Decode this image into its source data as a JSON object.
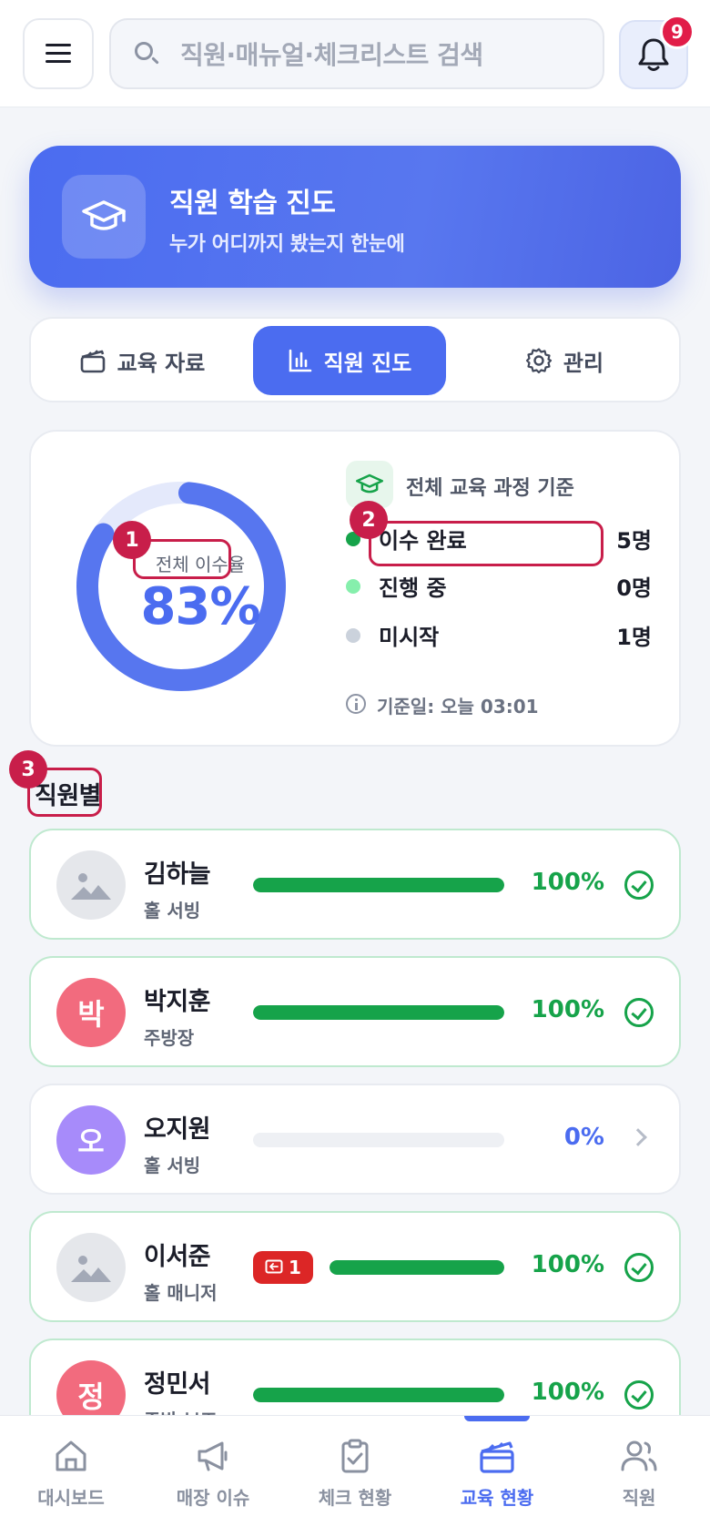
{
  "header": {
    "search_placeholder": "직원·매뉴얼·체크리스트 검색",
    "notification_count": "9",
    "icons": {
      "menu": "menu-icon",
      "search": "search-icon",
      "bell": "bell-icon"
    }
  },
  "hero": {
    "title": "직원 학습 진도",
    "subtitle": "누가 어디까지 봤는지 한눈에",
    "icon": "graduation-cap-icon"
  },
  "tabs": [
    {
      "label": "교육 자료",
      "icon": "clapperboard-icon",
      "active": false
    },
    {
      "label": "직원 진도",
      "icon": "bar-chart-icon",
      "active": true
    },
    {
      "label": "관리",
      "icon": "gear-icon",
      "active": false
    }
  ],
  "summary": {
    "completion_label": "전체 이수율",
    "completion_value": "83%",
    "completion_fraction": 0.83,
    "basis": "전체 교육 과정 기준",
    "stats": [
      {
        "label": "이수 완료",
        "value": "5명",
        "color": "#16a34a"
      },
      {
        "label": "진행 중",
        "value": "0명",
        "color": "#86efac"
      },
      {
        "label": "미시작",
        "value": "1명",
        "color": "#cbd2dc"
      }
    ],
    "as_of": "기준일: 오늘 03:01"
  },
  "annotations": [
    "1",
    "2",
    "3"
  ],
  "section_title": "직원별",
  "employees": [
    {
      "name": "김하늘",
      "role": "홀 서빙",
      "avatar": "",
      "avatar_type": "photo",
      "progress": 1.0,
      "percent": "100%",
      "status": "check",
      "feedback": null
    },
    {
      "name": "박지훈",
      "role": "주방장",
      "avatar": "박",
      "avatar_type": "initial",
      "avatar_color": "#f26b7e",
      "progress": 1.0,
      "percent": "100%",
      "status": "check",
      "feedback": null
    },
    {
      "name": "오지원",
      "role": "홀 서빙",
      "avatar": "오",
      "avatar_type": "initial",
      "avatar_color": "#a78bfa",
      "progress": 0.0,
      "percent": "0%",
      "status": "chevron",
      "feedback": null
    },
    {
      "name": "이서준",
      "role": "홀 매니저",
      "avatar": "",
      "avatar_type": "photo",
      "progress": 1.0,
      "percent": "100%",
      "status": "check",
      "feedback": "1"
    },
    {
      "name": "정민서",
      "role": "주방 보조",
      "avatar": "정",
      "avatar_type": "initial",
      "avatar_color": "#f26b7e",
      "progress": 1.0,
      "percent": "100%",
      "status": "check",
      "feedback": null
    }
  ],
  "nav": [
    {
      "label": "대시보드",
      "icon": "home-icon",
      "active": false
    },
    {
      "label": "매장 이슈",
      "icon": "megaphone-icon",
      "active": false
    },
    {
      "label": "체크 현황",
      "icon": "clipboard-check-icon",
      "active": false
    },
    {
      "label": "교육 현황",
      "icon": "clapperboard-icon",
      "active": true
    },
    {
      "label": "직원",
      "icon": "users-icon",
      "active": false
    }
  ],
  "colors": {
    "accent": "#4b6cf0",
    "success": "#16a34a",
    "danger": "#c81e4a"
  }
}
